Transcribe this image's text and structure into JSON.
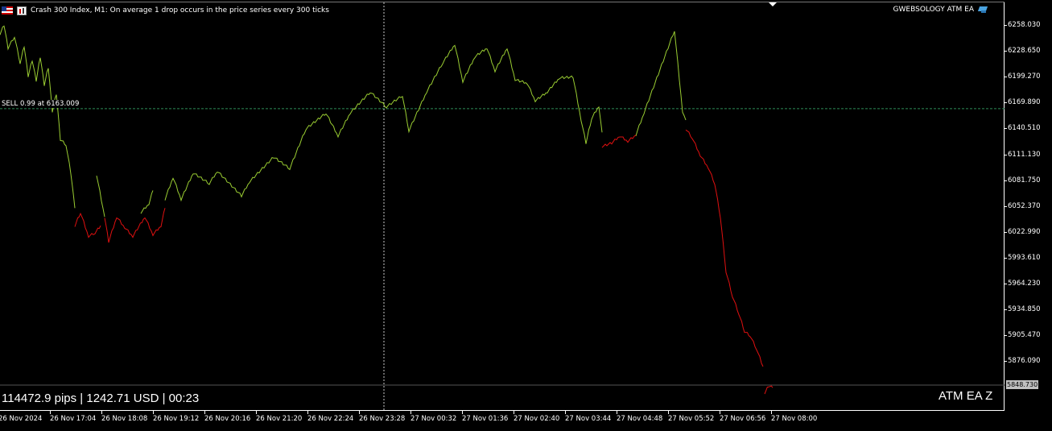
{
  "header": {
    "symbol_text": "Crash 300 Index, M1:  On average 1 drop occurs in the price series every 300 ticks",
    "ea_name": "GWEBSOLOGY ATM EA"
  },
  "sell_level_label": "SELL 0.99 at 6163.009",
  "stats_text": "114472.9 pips | 1242.71 USD | 00:23",
  "watermark_text": "ATM EA Z",
  "current_price": "5848.730",
  "price_axis": [
    "6258.030",
    "6228.650",
    "6199.270",
    "6169.890",
    "6140.510",
    "6111.130",
    "6081.750",
    "6052.370",
    "6022.990",
    "5993.610",
    "5964.230",
    "5934.850",
    "5905.470",
    "5876.090"
  ],
  "time_axis": [
    "26 Nov 2024",
    "26 Nov 17:04",
    "26 Nov 18:08",
    "26 Nov 19:12",
    "26 Nov 20:16",
    "26 Nov 21:20",
    "26 Nov 22:24",
    "26 Nov 23:28",
    "27 Nov 00:32",
    "27 Nov 01:36",
    "27 Nov 02:40",
    "27 Nov 03:44",
    "27 Nov 04:48",
    "27 Nov 05:52",
    "27 Nov 06:56",
    "27 Nov 08:00"
  ],
  "colors": {
    "background": "#000000",
    "up_line": "#9acd32",
    "down_line": "#e01010",
    "sell_line": "#2e8b57",
    "crosshair": "#c8c8c8"
  },
  "chart_data": {
    "type": "line",
    "title": "Crash 300 Index, M1",
    "y_range": [
      5848.73,
      6268
    ],
    "series": [
      {
        "name": "up",
        "color": "#9acd32",
        "segments": [
          [
            [
              0,
              6248
            ],
            [
              5,
              6258
            ],
            [
              10,
              6232
            ],
            [
              18,
              6245
            ],
            [
              25,
              6215
            ],
            [
              30,
              6234
            ],
            [
              35,
              6200
            ],
            [
              40,
              6218
            ],
            [
              45,
              6195
            ],
            [
              50,
              6222
            ],
            [
              55,
              6190
            ],
            [
              60,
              6210
            ],
            [
              65,
              6160
            ],
            [
              70,
              6180
            ],
            [
              75,
              6128
            ],
            [
              82,
              6122
            ],
            [
              88,
              6090
            ],
            [
              93,
              6050
            ]
          ],
          [
            [
              120,
              6088
            ],
            [
              130,
              6040
            ]
          ],
          [
            [
              175,
              6045
            ],
            [
              185,
              6055
            ],
            [
              190,
              6070
            ]
          ],
          [
            [
              205,
              6060
            ],
            [
              215,
              6085
            ],
            [
              225,
              6060
            ],
            [
              240,
              6090
            ],
            [
              260,
              6078
            ],
            [
              270,
              6092
            ],
            [
              300,
              6064
            ],
            [
              310,
              6080
            ],
            [
              340,
              6108
            ],
            [
              360,
              6095
            ],
            [
              380,
              6140
            ],
            [
              405,
              6158
            ],
            [
              420,
              6132
            ],
            [
              435,
              6158
            ],
            [
              460,
              6182
            ],
            [
              480,
              6165
            ],
            [
              500,
              6178
            ],
            [
              508,
              6138
            ],
            [
              530,
              6182
            ],
            [
              550,
              6215
            ],
            [
              565,
              6236
            ],
            [
              575,
              6194
            ],
            [
              590,
              6222
            ],
            [
              605,
              6232
            ],
            [
              615,
              6206
            ],
            [
              630,
              6232
            ],
            [
              640,
              6196
            ],
            [
              655,
              6192
            ],
            [
              665,
              6172
            ],
            [
              680,
              6182
            ],
            [
              695,
              6198
            ],
            [
              712,
              6199
            ],
            [
              722,
              6150
            ],
            [
              728,
              6124
            ],
            [
              735,
              6152
            ],
            [
              744,
              6166
            ],
            [
              748,
              6136
            ]
          ],
          [
            [
              790,
              6133
            ],
            [
              800,
              6158
            ],
            [
              838,
              6252
            ],
            [
              848,
              6160
            ],
            [
              852,
              6150
            ]
          ]
        ]
      },
      {
        "name": "down",
        "color": "#e01010",
        "segments": [
          [
            [
              93,
              6030
            ],
            [
              100,
              6045
            ],
            [
              110,
              6018
            ],
            [
              118,
              6022
            ],
            [
              125,
              6030
            ]
          ],
          [
            [
              130,
              6040
            ],
            [
              135,
              6012
            ],
            [
              145,
              6040
            ],
            [
              155,
              6028
            ],
            [
              165,
              6018
            ],
            [
              180,
              6040
            ],
            [
              190,
              6020
            ],
            [
              200,
              6030
            ],
            [
              205,
              6050
            ]
          ],
          [
            [
              748,
              6120
            ],
            [
              760,
              6124
            ],
            [
              770,
              6132
            ],
            [
              780,
              6126
            ],
            [
              790,
              6133
            ]
          ],
          [
            [
              852,
              6140
            ],
            [
              860,
              6130
            ],
            [
              870,
              6110
            ],
            [
              880,
              6096
            ],
            [
              888,
              6078
            ],
            [
              895,
              6040
            ],
            [
              902,
              5978
            ],
            [
              910,
              5950
            ],
            [
              918,
              5930
            ],
            [
              925,
              5910
            ],
            [
              932,
              5905
            ],
            [
              940,
              5890
            ],
            [
              948,
              5870
            ]
          ],
          [
            [
              950,
              5840
            ],
            [
              955,
              5848
            ],
            [
              960,
              5846
            ]
          ]
        ]
      }
    ]
  }
}
